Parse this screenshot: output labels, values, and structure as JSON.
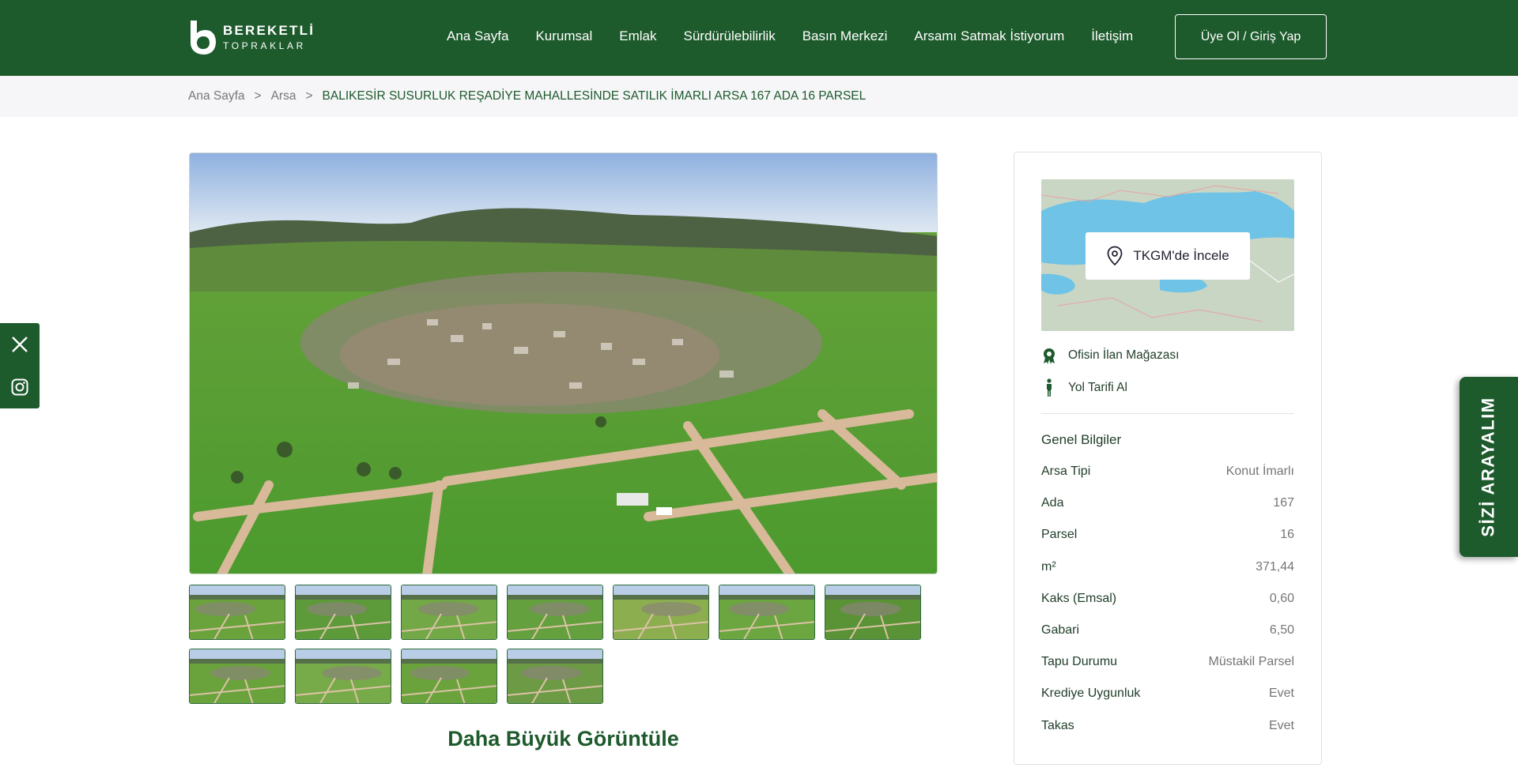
{
  "brand": {
    "line1": "BEREKETLİ",
    "line2": "TOPRAKLAR"
  },
  "nav": [
    {
      "label": "Ana Sayfa"
    },
    {
      "label": "Kurumsal"
    },
    {
      "label": "Emlak"
    },
    {
      "label": "Sürdürülebilirlik"
    },
    {
      "label": "Basın Merkezi"
    },
    {
      "label": "Arsamı Satmak İstiyorum"
    },
    {
      "label": "İletişim"
    }
  ],
  "login_label": "Üye Ol / Giriş Yap",
  "breadcrumb": {
    "home": "Ana Sayfa",
    "category": "Arsa",
    "current": "BALIKESİR SUSURLUK REŞADİYE MAHALLESİNDE SATILIK İMARLI ARSA 167 ADA 16 PARSEL",
    "separator": ">"
  },
  "gallery": {
    "thumb_count": 11,
    "bigger_label": "Daha Büyük Görüntüle"
  },
  "side": {
    "map_button": "TKGM'de İncele",
    "store_link": "Ofisin İlan Mağazası",
    "directions_link": "Yol Tarifi Al",
    "general_title": "Genel Bilgiler",
    "info": [
      {
        "key": "Arsa Tipi",
        "value": "Konut İmarlı"
      },
      {
        "key": "Ada",
        "value": "167"
      },
      {
        "key": "Parsel",
        "value": "16"
      },
      {
        "key": "m²",
        "value": "371,44"
      },
      {
        "key": "Kaks (Emsal)",
        "value": "0,60"
      },
      {
        "key": "Gabari",
        "value": "6,50"
      },
      {
        "key": "Tapu Durumu",
        "value": "Müstakil Parsel"
      },
      {
        "key": "Krediye Uygunluk",
        "value": "Evet"
      },
      {
        "key": "Takas",
        "value": "Evet"
      }
    ]
  },
  "callback_label": "SİZİ ARAYALIM",
  "colors": {
    "brand_green": "#1d5a2c",
    "breadcrumb_bg": "#f6f6f8"
  }
}
